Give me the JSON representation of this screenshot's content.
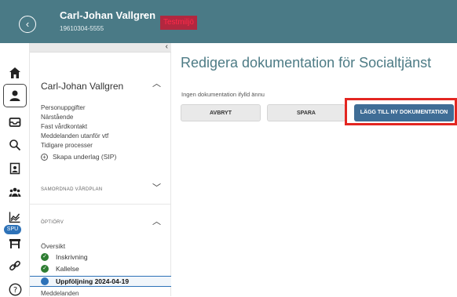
{
  "header": {
    "user_name": "Carl-Johan Vallgren",
    "personnummer": "19610304-5555",
    "environment_badge": "Testmiljö",
    "back_icon": "back-circle-icon",
    "user_menu_icon": "chevron-down-icon",
    "bg_color": "#4a7a86"
  },
  "rail": {
    "icons": [
      "home-icon",
      "person-icon",
      "inbox-icon",
      "search-icon",
      "document-icon",
      "group-icon",
      "chart-icon",
      "cart-icon",
      "link-icon",
      "help-icon"
    ],
    "active": "person-icon",
    "spu_badge": "SPU"
  },
  "panel": {
    "title": "Carl-Johan Vallgren",
    "items": [
      "Personuppgifter",
      "Närstående",
      "Fast vårdkontakt",
      "Meddelanden utanför vtf",
      "Tidigare processer"
    ],
    "sip_action": "Skapa underlag (SIP)",
    "section_samordnad": "SAMORDNAD VÅRDPLAN",
    "section_oppen": "ÖPTIÖRV",
    "oversikt": "Översikt",
    "steps": [
      {
        "label": "Inskrivning",
        "status": "done"
      },
      {
        "label": "Kallelse",
        "status": "done"
      },
      {
        "label": "Uppföljning 2024-04-19",
        "status": "active"
      }
    ],
    "partial_item": "Meddelanden"
  },
  "main": {
    "title": "Redigera dokumentation för Socialtjänst",
    "status_text": "Ingen dokumentation ifylld ännu",
    "cancel_label": "AVBRYT",
    "save_label": "SPARA",
    "add_label": "LÄGG TILL NY DOKUMENTATION",
    "accent_color": "#3f6d96",
    "highlight_color": "#e32621"
  }
}
